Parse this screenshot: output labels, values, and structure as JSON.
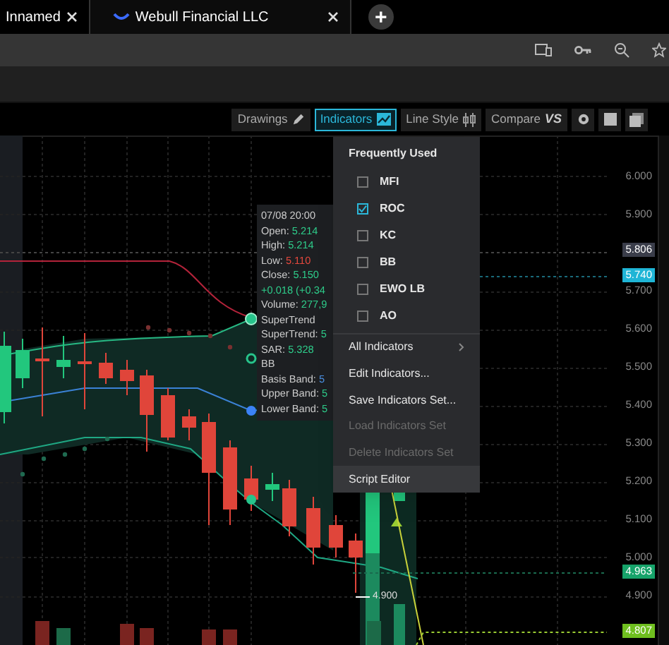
{
  "browser": {
    "tabs": [
      {
        "title": "Innamed",
        "selected": false
      },
      {
        "title": "Webull Financial LLC",
        "selected": true
      }
    ],
    "new_tab": "+"
  },
  "chart_toolbar": {
    "buttons": [
      {
        "label": "Drawings",
        "kind": "pencil",
        "selected": false
      },
      {
        "label": "Indicators",
        "kind": "indicators",
        "selected": true
      },
      {
        "label": "Line Style",
        "kind": "candles",
        "selected": false
      },
      {
        "label": "Compare",
        "kind": "compare",
        "badge": "VS",
        "selected": false
      }
    ]
  },
  "price_axis": [
    {
      "value": "6.000",
      "kind": "tick"
    },
    {
      "value": "5.900",
      "kind": "tick"
    },
    {
      "value": "5.806",
      "kind": "tag",
      "color": "#3a3d4a"
    },
    {
      "value": "5.740",
      "kind": "tag",
      "color": "#1fb5d6"
    },
    {
      "value": "5.700",
      "kind": "tick"
    },
    {
      "value": "5.600",
      "kind": "tick"
    },
    {
      "value": "5.500",
      "kind": "tick"
    },
    {
      "value": "5.400",
      "kind": "tick"
    },
    {
      "value": "5.300",
      "kind": "tick"
    },
    {
      "value": "5.200",
      "kind": "tick"
    },
    {
      "value": "5.100",
      "kind": "tick"
    },
    {
      "value": "5.000",
      "kind": "tick"
    },
    {
      "value": "4.963",
      "kind": "tag",
      "color": "#16a36a"
    },
    {
      "value": "4.900",
      "kind": "tick"
    },
    {
      "value": "4.807",
      "kind": "tag",
      "color": "#6fbf1f"
    }
  ],
  "low_marker": "4.900",
  "tooltip": {
    "date": "07/08 20:00",
    "rows": [
      {
        "label": "Open:",
        "value": "5.214",
        "color": "#2ecc8a"
      },
      {
        "label": "High:",
        "value": "5.214",
        "color": "#2ecc8a"
      },
      {
        "label": "Low:",
        "value": "5.110",
        "color": "#e5483d"
      },
      {
        "label": "Close:",
        "value": "5.150",
        "color": "#2ecc8a"
      },
      {
        "value": "+0.018 (+0.34",
        "color": "#2ecc8a"
      },
      {
        "label": "Volume:",
        "value": "277,9",
        "color": "#2ecc8a"
      },
      {
        "label": "SuperTrend"
      },
      {
        "label": "SuperTrend:",
        "value": "5",
        "color": "#2ecc8a"
      },
      {
        "label": "SAR:",
        "value": "5.328",
        "color": "#2ecc8a"
      },
      {
        "label": "BB"
      },
      {
        "label": "Basis Band:",
        "value": "5",
        "color": "#4a8fe0"
      },
      {
        "label": "Upper Band:",
        "value": "5",
        "color": "#2ecc8a"
      },
      {
        "label": "Lower Band:",
        "value": "5",
        "color": "#2ecc8a"
      }
    ]
  },
  "indicators_menu": {
    "header": "Frequently Used",
    "favorites": [
      {
        "label": "MFI",
        "checked": false
      },
      {
        "label": "ROC",
        "checked": true
      },
      {
        "label": "KC",
        "checked": false
      },
      {
        "label": "BB",
        "checked": false
      },
      {
        "label": "EWO LB",
        "checked": false
      },
      {
        "label": "AO",
        "checked": false
      }
    ],
    "actions": [
      {
        "label": "All Indicators",
        "submenu": true,
        "disabled": false,
        "selected": false
      },
      {
        "label": "Edit Indicators...",
        "submenu": false,
        "disabled": false,
        "selected": false
      },
      {
        "label": "Save Indicators Set...",
        "submenu": false,
        "disabled": false,
        "selected": false
      },
      {
        "label": "Load Indicators Set",
        "submenu": false,
        "disabled": true,
        "selected": false
      },
      {
        "label": "Delete Indicators Set",
        "submenu": false,
        "disabled": true,
        "selected": false
      },
      {
        "label": "Script Editor",
        "submenu": false,
        "disabled": false,
        "selected": true
      }
    ]
  }
}
